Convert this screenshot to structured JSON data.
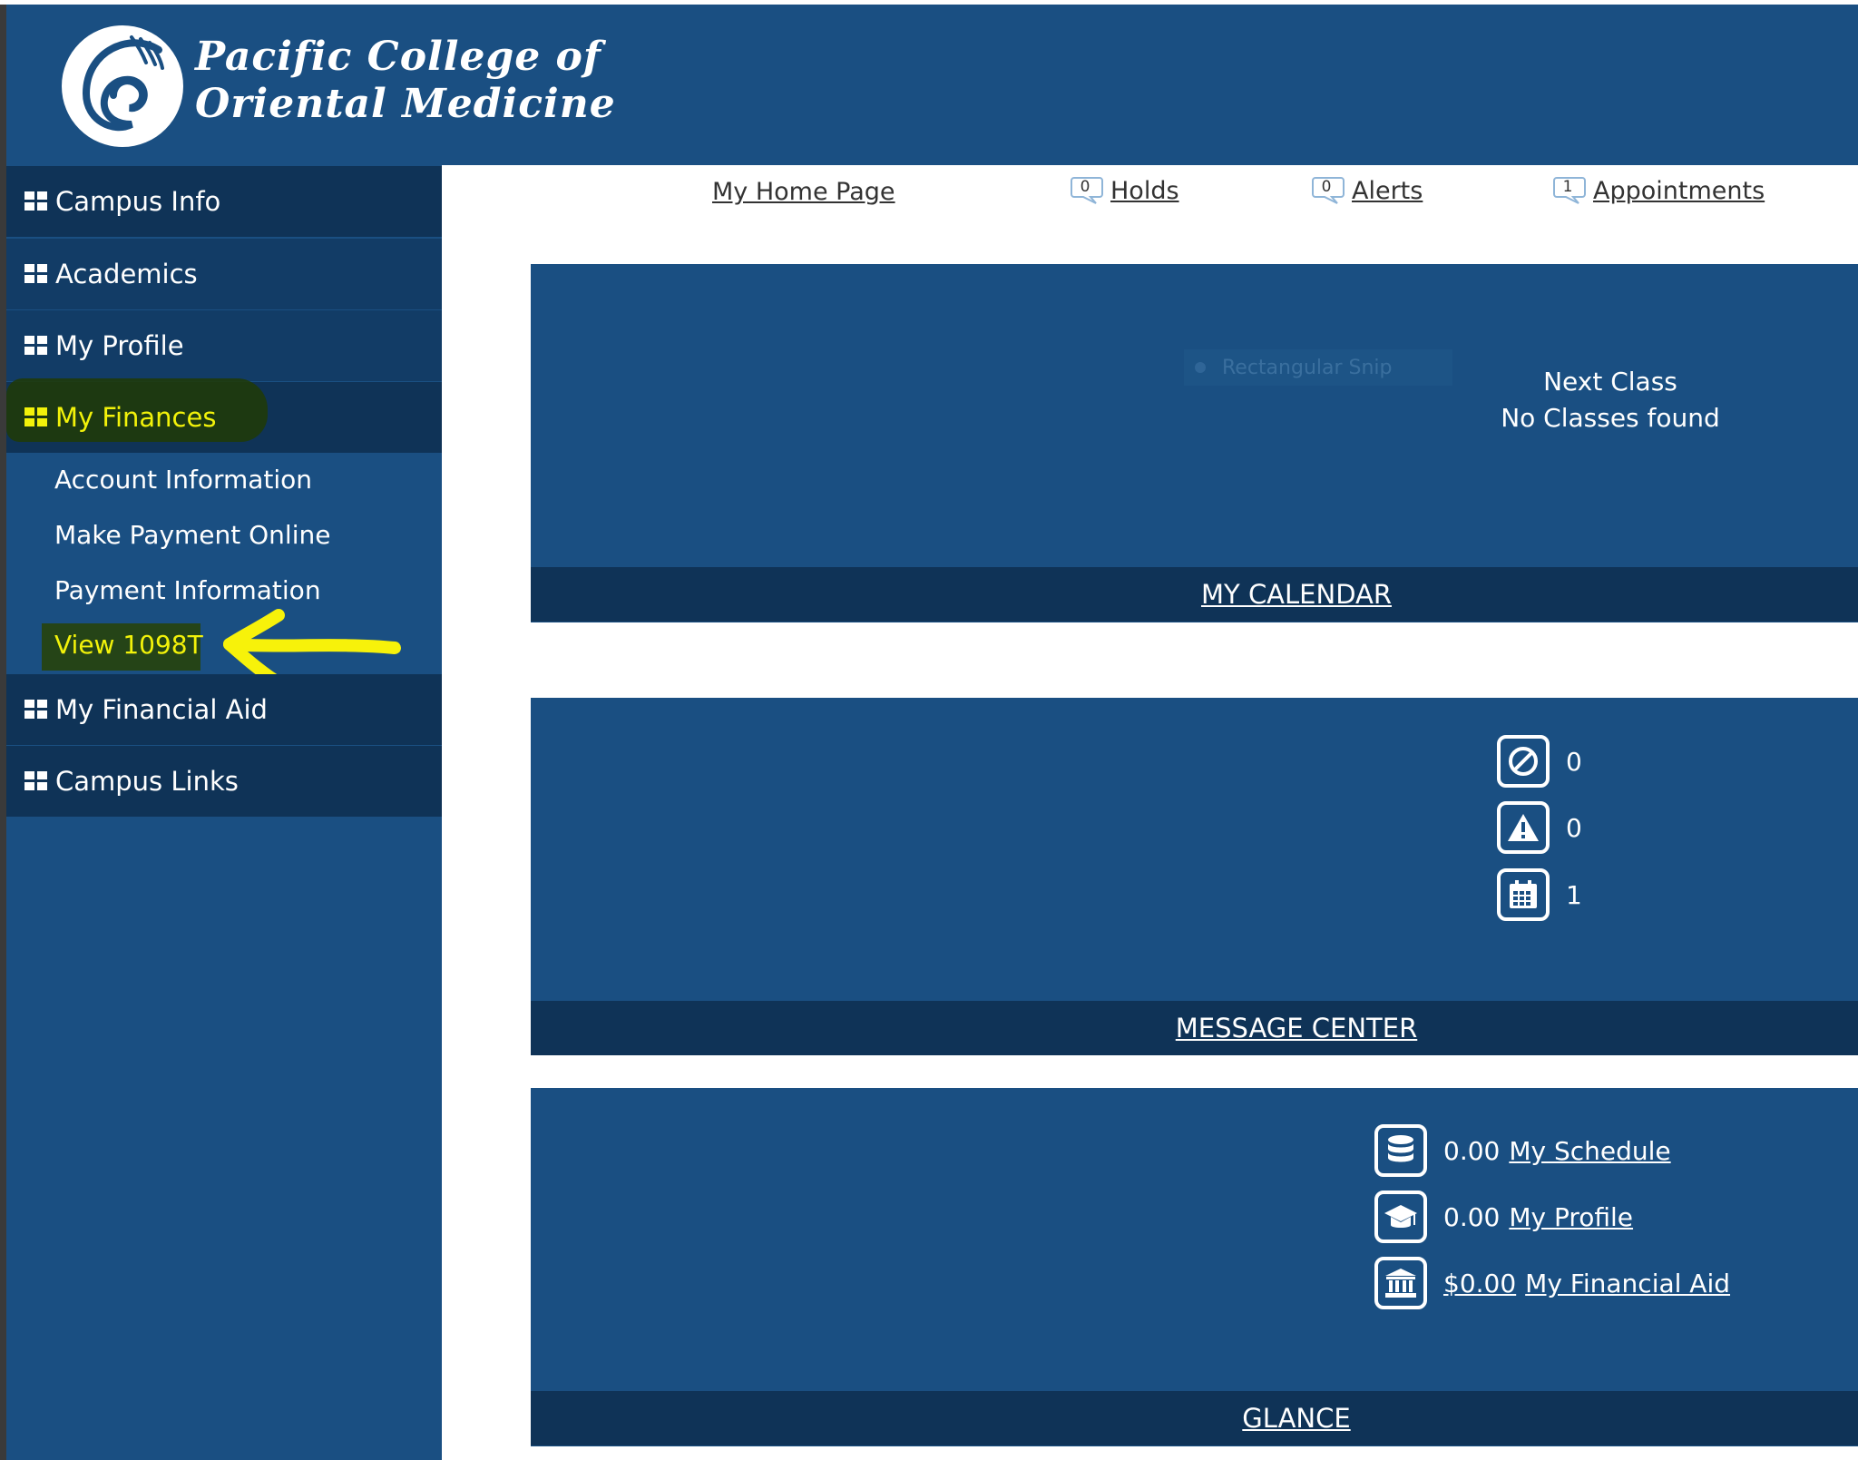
{
  "header": {
    "brand_line1": "Pacific College of",
    "brand_line2": "Oriental Medicine",
    "logo_icon": "wave-logo-icon"
  },
  "sidebar": {
    "items": [
      {
        "label": "Campus Info",
        "icon": "grid-icon"
      },
      {
        "label": "Academics",
        "icon": "grid-icon"
      },
      {
        "label": "My Profile",
        "icon": "grid-icon"
      },
      {
        "label": "My Finances",
        "icon": "grid-icon"
      },
      {
        "label": "My Financial Aid",
        "icon": "grid-icon"
      },
      {
        "label": "Campus Links",
        "icon": "grid-icon"
      }
    ],
    "finances_subitems": [
      {
        "label": "Account Information"
      },
      {
        "label": "Make Payment Online"
      },
      {
        "label": "Payment Information"
      },
      {
        "label": "View 1098T"
      }
    ],
    "highlight_color": "#f2f20a"
  },
  "topnav": {
    "home": "My Home Page",
    "holds": {
      "label": "Holds",
      "count": "0"
    },
    "alerts": {
      "label": "Alerts",
      "count": "0"
    },
    "appointments": {
      "label": "Appointments",
      "count": "1"
    }
  },
  "calendar_panel": {
    "snip_overlay": "Rectangular Snip",
    "next_class_title": "Next Class",
    "next_class_value": "No Classes found",
    "footer_link": "MY CALENDAR"
  },
  "message_panel": {
    "rows": [
      {
        "icon": "ban-icon",
        "value": "0"
      },
      {
        "icon": "warning-icon",
        "value": "0"
      },
      {
        "icon": "calendar-icon",
        "value": "1"
      }
    ],
    "footer_link": "MESSAGE CENTER"
  },
  "glance_panel": {
    "rows": [
      {
        "icon": "database-icon",
        "value": "0.00",
        "link": "My Schedule"
      },
      {
        "icon": "graduation-cap-icon",
        "value": "0.00",
        "link": "My Profile"
      },
      {
        "icon": "bank-icon",
        "value": "$0.00",
        "link": "My Financial Aid"
      }
    ],
    "footer_link": "GLANCE"
  },
  "colors": {
    "primary": "#1a4f82",
    "dark": "#0f3357"
  }
}
